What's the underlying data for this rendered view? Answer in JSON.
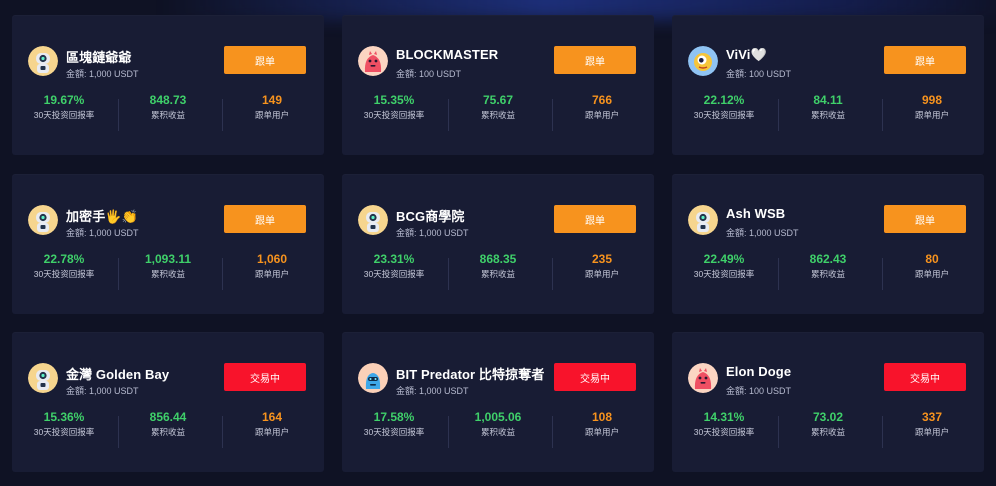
{
  "stat_labels": {
    "roi": "30天投资回报率",
    "profit": "累积收益",
    "followers": "跟单用户"
  },
  "colors": {
    "follow_button": "#f7931e",
    "trading_button": "#f8132b",
    "roi": "#3fd06a",
    "profit": "#3fd06a",
    "followers": "#f7931e",
    "card_bg": "#181c34",
    "page_bg": "#0f1224"
  },
  "traders": [
    {
      "name": "區塊鏈爺爺",
      "amount": "金額: 1,000 USDT",
      "roi": "19.67%",
      "profit": "848.73",
      "followers": "149",
      "button": "跟单",
      "button_state": "follow",
      "avatar_icon": "robot-avatar-icon"
    },
    {
      "name": "BLOCKMASTER",
      "amount": "金額: 100 USDT",
      "roi": "15.35%",
      "profit": "75.67",
      "followers": "766",
      "button": "跟单",
      "button_state": "follow",
      "avatar_icon": "pink-monster-avatar-icon"
    },
    {
      "name": "ViVi🤍",
      "amount": "金額: 100 USDT",
      "roi": "22.12%",
      "profit": "84.11",
      "followers": "998",
      "button": "跟单",
      "button_state": "follow",
      "avatar_icon": "one-eyed-monster-avatar-icon"
    },
    {
      "name": "加密手🖐👏",
      "amount": "金額: 1,000 USDT",
      "roi": "22.78%",
      "profit": "1,093.11",
      "followers": "1,060",
      "button": "跟单",
      "button_state": "follow",
      "avatar_icon": "robot-avatar-icon"
    },
    {
      "name": "BCG商學院",
      "amount": "金額: 1,000 USDT",
      "roi": "23.31%",
      "profit": "868.35",
      "followers": "235",
      "button": "跟单",
      "button_state": "follow",
      "avatar_icon": "robot-avatar-icon"
    },
    {
      "name": "Ash WSB",
      "amount": "金額: 1,000 USDT",
      "roi": "22.49%",
      "profit": "862.43",
      "followers": "80",
      "button": "跟单",
      "button_state": "follow",
      "avatar_icon": "robot-avatar-icon"
    },
    {
      "name": "金灣 Golden Bay",
      "amount": "金額: 1,000 USDT",
      "roi": "15.36%",
      "profit": "856.44",
      "followers": "164",
      "button": "交易中",
      "button_state": "trading",
      "avatar_icon": "robot-avatar-icon"
    },
    {
      "name": "BIT Predator 比特掠奪者",
      "amount": "金額: 1,000 USDT",
      "roi": "17.58%",
      "profit": "1,005.06",
      "followers": "108",
      "button": "交易中",
      "button_state": "trading",
      "avatar_icon": "blue-monster-avatar-icon"
    },
    {
      "name": "Elon Doge",
      "amount": "金額: 100 USDT",
      "roi": "14.31%",
      "profit": "73.02",
      "followers": "337",
      "button": "交易中",
      "button_state": "trading",
      "avatar_icon": "pink-monster-avatar-icon"
    }
  ]
}
